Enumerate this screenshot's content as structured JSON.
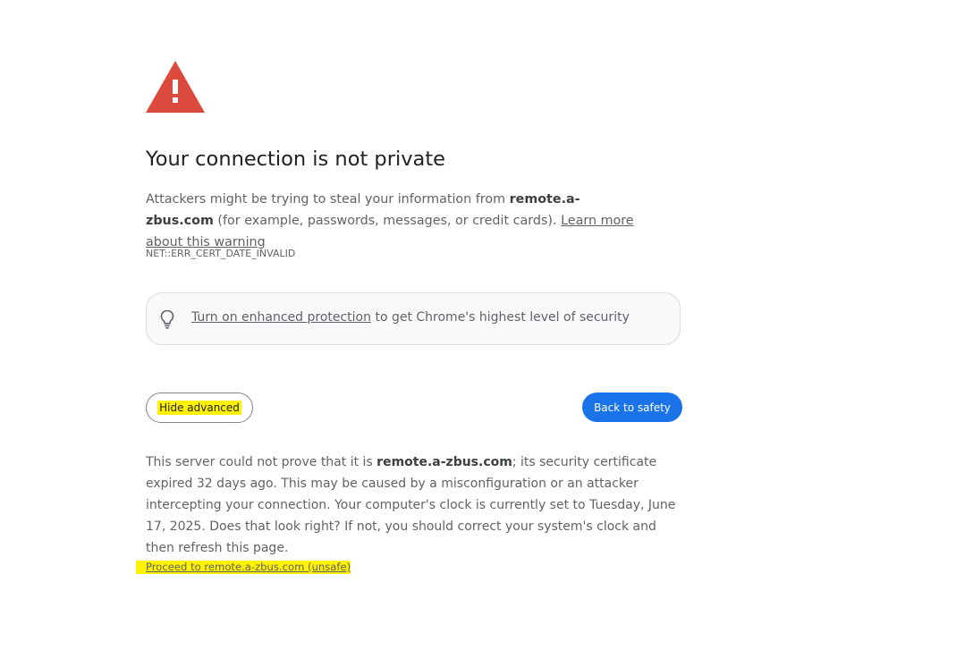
{
  "interstitial": {
    "title": "Your connection is not private",
    "intro_prefix": "Attackers might be trying to steal your information from ",
    "host": "remote.a-zbus.com",
    "intro_suffix": " (for example, passwords, messages, or credit cards). ",
    "learn_more_link": "Learn more about this warning",
    "error_code": "NET::ERR_CERT_DATE_INVALID",
    "warning_icon": "warning-triangle-icon",
    "warning_color": "#dc4a3d"
  },
  "enhanced_protection": {
    "icon": "lightbulb-icon",
    "link": "Turn on enhanced protection",
    "suffix": " to get Chrome's highest level of security"
  },
  "buttons": {
    "hide_advanced": "Hide advanced",
    "back_to_safety": "Back to safety",
    "primary_color": "#1a73e8",
    "highlight_color": "#fff200"
  },
  "details": {
    "prefix": "This server could not prove that it is ",
    "host": "remote.a-zbus.com",
    "suffix": "; its security certificate expired 32 days ago. This may be caused by a misconfiguration or an attacker intercepting your connection. Your computer's clock is currently set to Tuesday, June 17, 2025. Does that look right? If not, you should correct your system's clock and then refresh this page."
  },
  "proceed_link": "Proceed to remote.a-zbus.com (unsafe)"
}
